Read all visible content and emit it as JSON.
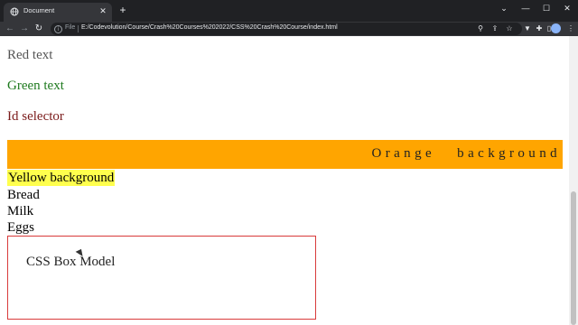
{
  "browser": {
    "tab_title": "Document",
    "tab_close": "✕",
    "new_tab": "+",
    "window_buttons": [
      "⌄",
      "—",
      "☐",
      "✕"
    ],
    "nav": {
      "back": "←",
      "forward": "→",
      "reload": "↻"
    },
    "url_scheme": "File",
    "url": "E:/Codevolution/Course/Crash%20Courses%202022/CSS%20Crash%20Course/index.html",
    "icons": [
      "zoom-icon",
      "share-icon",
      "bookmark-star-icon",
      "extension-icon",
      "puzzle-icon",
      "sidebar-icon",
      "profile-avatar",
      "menu-icon"
    ]
  },
  "page": {
    "red_text": "Red text",
    "green_text": "Green text",
    "id_selector_text": "Id selector",
    "orange_background_text": "Orange background",
    "yellow_background_text": "Yellow background",
    "list_items": [
      "Bread",
      "Milk",
      "Eggs"
    ],
    "box_text": "CSS Box Model"
  },
  "colors": {
    "orange": "#ffa500",
    "yellow": "#ffff4d",
    "green": "#1f7a1f",
    "box_border": "#d93b3b"
  }
}
